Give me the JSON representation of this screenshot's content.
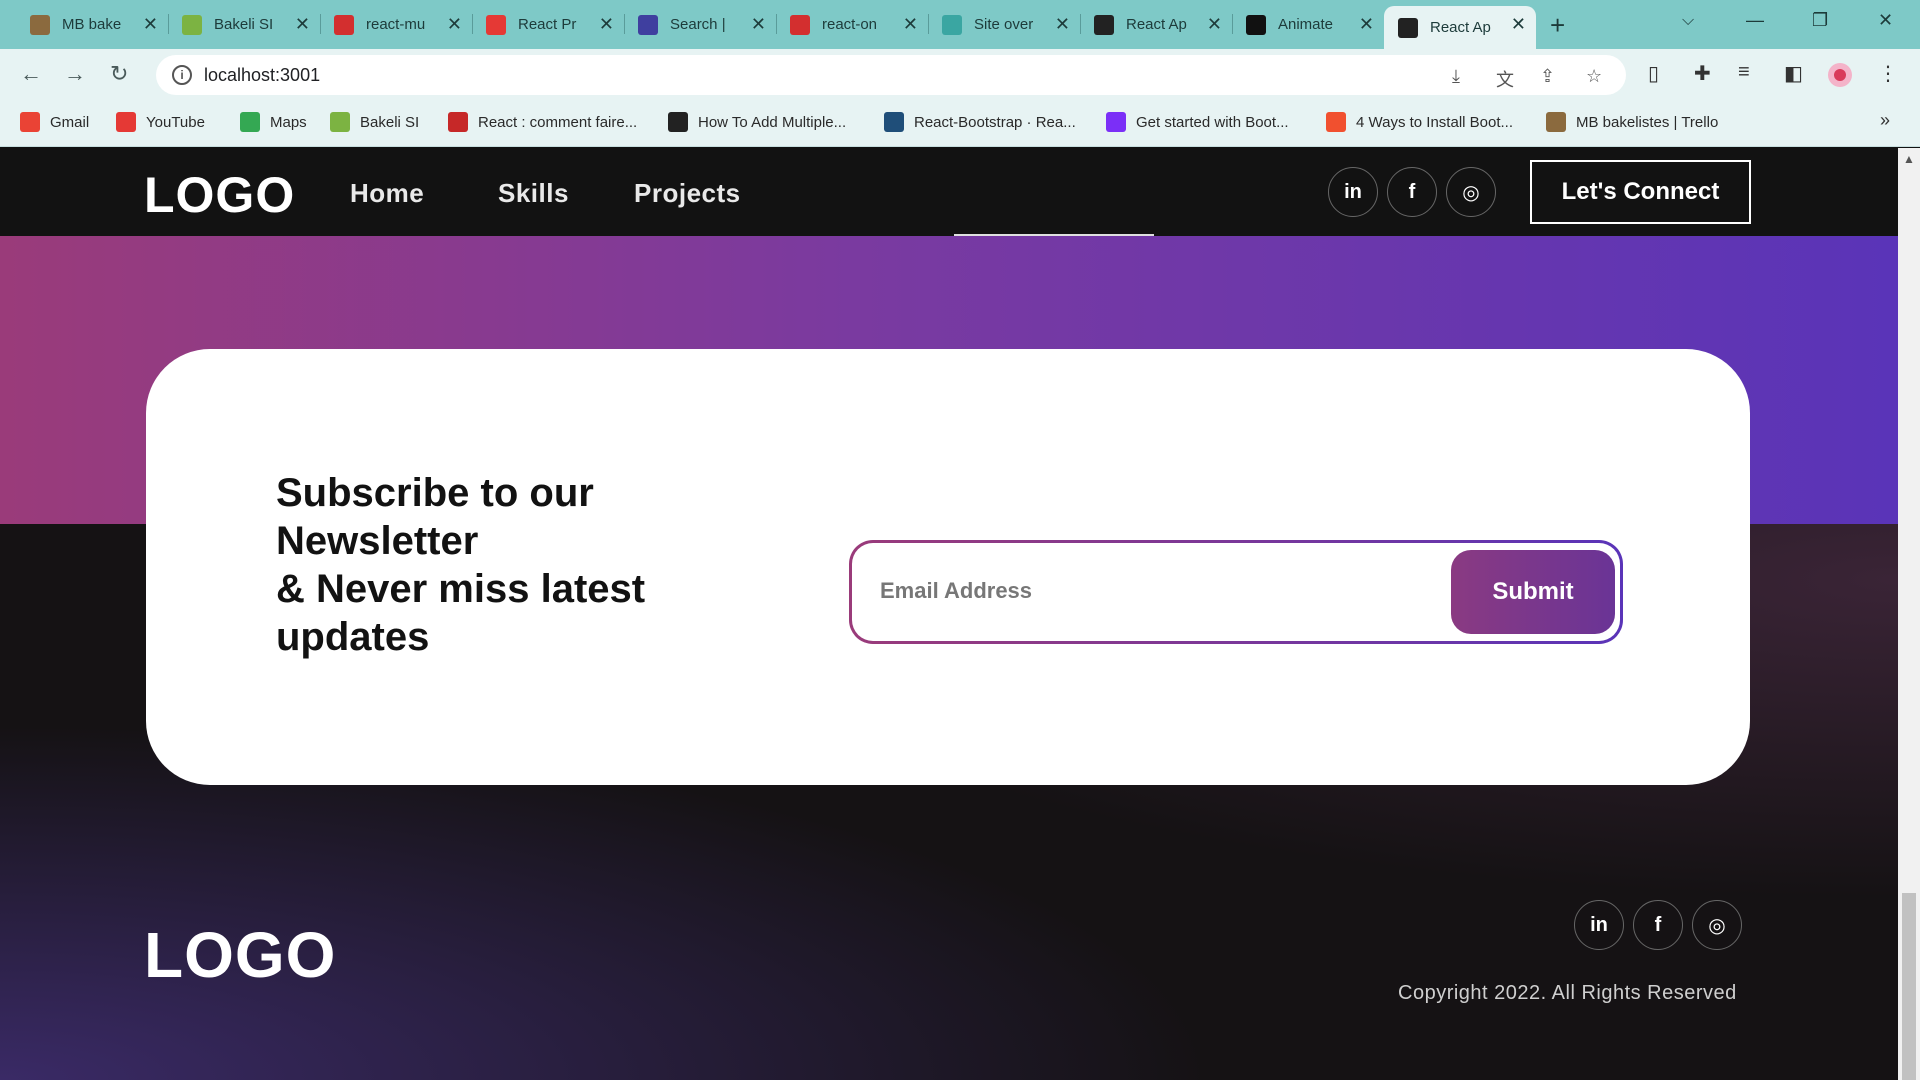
{
  "browser": {
    "tabs": [
      {
        "title": "MB bake",
        "icon": "trello-icon",
        "color": "#8b6a3e"
      },
      {
        "title": "Bakeli SI",
        "icon": "bakeli-icon",
        "color": "#7cb342"
      },
      {
        "title": "react-mu",
        "icon": "n-icon",
        "color": "#d32f2f"
      },
      {
        "title": "React Pr",
        "icon": "youtube-icon",
        "color": "#e53935"
      },
      {
        "title": "Search |",
        "icon": "search-app-icon",
        "color": "#3f3f9f"
      },
      {
        "title": "react-on",
        "icon": "n-icon",
        "color": "#d32f2f"
      },
      {
        "title": "Site over",
        "icon": "diamond-icon",
        "color": "#3aa6a2"
      },
      {
        "title": "React Ap",
        "icon": "react-icon",
        "color": "#222222"
      },
      {
        "title": "Animate",
        "icon": "a-icon",
        "color": "#111111"
      },
      {
        "title": "React Ap",
        "icon": "react-icon",
        "color": "#222222"
      }
    ],
    "url": "localhost:3001"
  },
  "bookmarks": [
    {
      "label": "Gmail",
      "icon": "gmail-icon",
      "color": "#ea4335"
    },
    {
      "label": "YouTube",
      "icon": "youtube-icon",
      "color": "#e53935"
    },
    {
      "label": "Maps",
      "icon": "maps-icon",
      "color": "#34a853"
    },
    {
      "label": "Bakeli SI",
      "icon": "bakeli-icon",
      "color": "#7cb342"
    },
    {
      "label": "React : comment faire...",
      "icon": "j-icon",
      "color": "#c62828"
    },
    {
      "label": "How To Add Multiple...",
      "icon": "page-icon",
      "color": "#222222"
    },
    {
      "label": "React-Bootstrap · Rea...",
      "icon": "rb-icon",
      "color": "#1f4e79"
    },
    {
      "label": "Get started with Boot...",
      "icon": "bootstrap-icon",
      "color": "#7b2ff7"
    },
    {
      "label": "4 Ways to Install Boot...",
      "icon": "git-icon",
      "color": "#f1502f"
    },
    {
      "label": "MB bakelistes | Trello",
      "icon": "trello-icon",
      "color": "#8b6a3e"
    }
  ],
  "site": {
    "logo": "LOGO",
    "nav": [
      "Home",
      "Skills",
      "Projects"
    ],
    "social": [
      "in",
      "f",
      "◎"
    ],
    "connect_label": "Let's Connect"
  },
  "newsletter": {
    "title_lines": [
      "Subscribe to our",
      "Newsletter",
      "& Never miss latest",
      "updates"
    ],
    "email_placeholder": "Email Address",
    "submit_label": "Submit"
  },
  "footer": {
    "logo": "LOGO",
    "copyright": "Copyright 2022. All Rights Reserved"
  }
}
